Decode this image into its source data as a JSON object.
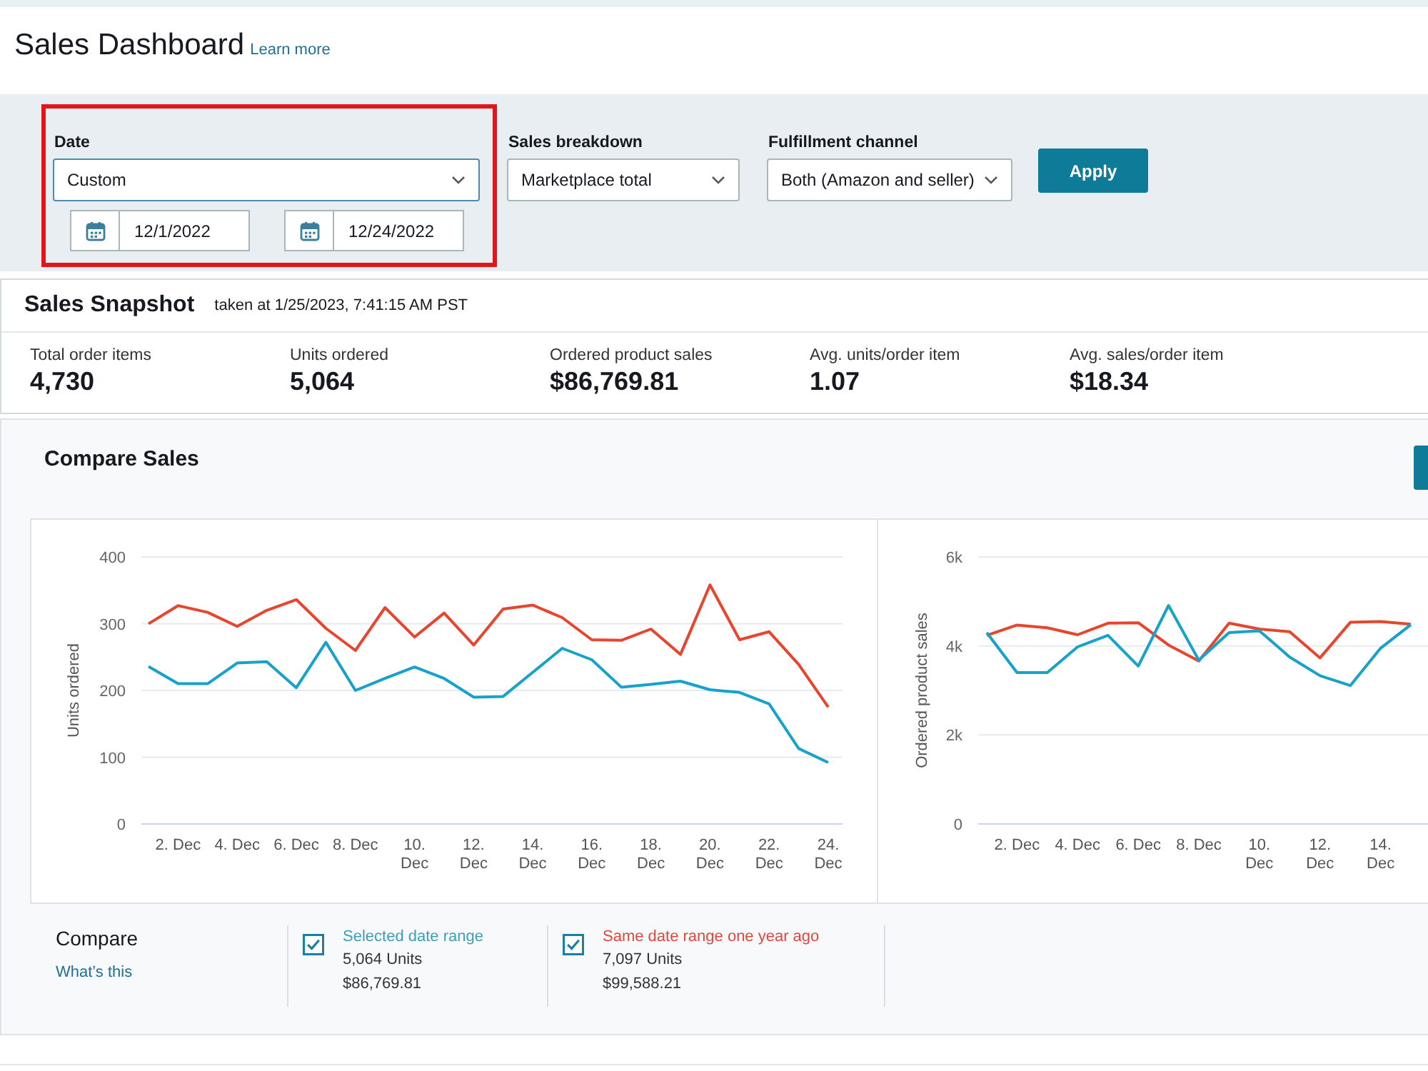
{
  "page": {
    "title": "Sales Dashboard",
    "learn_more_link": "Learn more"
  },
  "filters": {
    "date": {
      "label": "Date",
      "value": "Custom",
      "focused": true,
      "highlighted": true,
      "start_date": "12/1/2022",
      "end_date": "12/24/2022"
    },
    "sales_breakdown": {
      "label": "Sales breakdown",
      "value": "Marketplace total",
      "focused": false
    },
    "fulfillment_channel": {
      "label": "Fulfillment channel",
      "value": "Both (Amazon and seller)",
      "focused": false
    },
    "apply_button": "Apply"
  },
  "snapshot": {
    "title": "Sales Snapshot",
    "taken_at": "taken at 1/25/2023, 7:41:15 AM PST",
    "metrics": [
      {
        "label": "Total order items",
        "value": "4,730"
      },
      {
        "label": "Units ordered",
        "value": "5,064"
      },
      {
        "label": "Ordered product sales",
        "value": "$86,769.81"
      },
      {
        "label": "Avg. units/order item",
        "value": "1.07"
      },
      {
        "label": "Avg. sales/order item",
        "value": "$18.34"
      }
    ]
  },
  "compare_sales": {
    "title": "Compare Sales",
    "units_chart": {
      "chart_data": {
        "type": "line",
        "ylabel": "Units ordered",
        "categories": [
          null,
          "2. Dec",
          null,
          "4. Dec",
          null,
          "6. Dec",
          null,
          "8. Dec",
          null,
          "10. Dec",
          null,
          "12. Dec",
          null,
          "14. Dec",
          null,
          "16. Dec",
          null,
          "18. Dec",
          null,
          "20. Dec",
          null,
          "22. Dec",
          null,
          "24. Dec"
        ],
        "ylim": [
          0,
          400
        ],
        "yticks": [
          0,
          100,
          200,
          300,
          400
        ],
        "grid": true,
        "series": [
          {
            "color": "#18a2c9",
            "values": [
              236,
              210,
              210,
              241,
              243,
              204,
              272,
              200,
              218,
              235,
              218,
              190,
              191,
              227,
              263,
              246,
              205,
              209,
              214,
              201,
              197,
              180,
              113,
              92
            ]
          },
          {
            "color": "#e8452f",
            "values": [
              300,
              327,
              317,
              296,
              320,
              336,
              293,
              260,
              324,
              280,
              316,
              268,
              322,
              328,
              309,
              276,
              275,
              292,
              254,
              358,
              276,
              288,
              239,
              175
            ]
          }
        ]
      }
    },
    "sales_chart": {
      "chart_data": {
        "type": "line",
        "ylabel": "Ordered product sales",
        "categories": [
          null,
          "2. Dec",
          null,
          "4. Dec",
          null,
          "6. Dec",
          null,
          "8. Dec",
          null,
          "10. Dec",
          null,
          "12. Dec",
          null,
          "14. Dec",
          null
        ],
        "ylim": [
          0,
          6000
        ],
        "yticks": [
          {
            "value": 0,
            "label": "0"
          },
          {
            "value": 2000,
            "label": "2k"
          },
          {
            "value": 4000,
            "label": "4k"
          },
          {
            "value": 6000,
            "label": "6k"
          }
        ],
        "grid": true,
        "series": [
          {
            "color": "#18a2c9",
            "values": [
              4300,
              3400,
              3400,
              3980,
              4240,
              3550,
              4910,
              3680,
              4300,
              4340,
              3750,
              3330,
              3110,
              3950,
              4480
            ]
          },
          {
            "color": "#e8452f",
            "values": [
              4240,
              4470,
              4410,
              4250,
              4510,
              4520,
              4020,
              3660,
              4510,
              4380,
              4320,
              3730,
              4530,
              4550,
              4490
            ]
          }
        ]
      }
    },
    "compare": {
      "label": "Compare",
      "help_link": "What’s this",
      "ranges": [
        {
          "label": "Selected date range",
          "units": "5,064 Units",
          "sales": "$86,769.81",
          "checked": true,
          "color": "#3f9db5"
        },
        {
          "label": "Same date range one year ago",
          "units": "7,097 Units",
          "sales": "$99,588.21",
          "checked": true,
          "color": "#e0473c"
        }
      ]
    }
  }
}
